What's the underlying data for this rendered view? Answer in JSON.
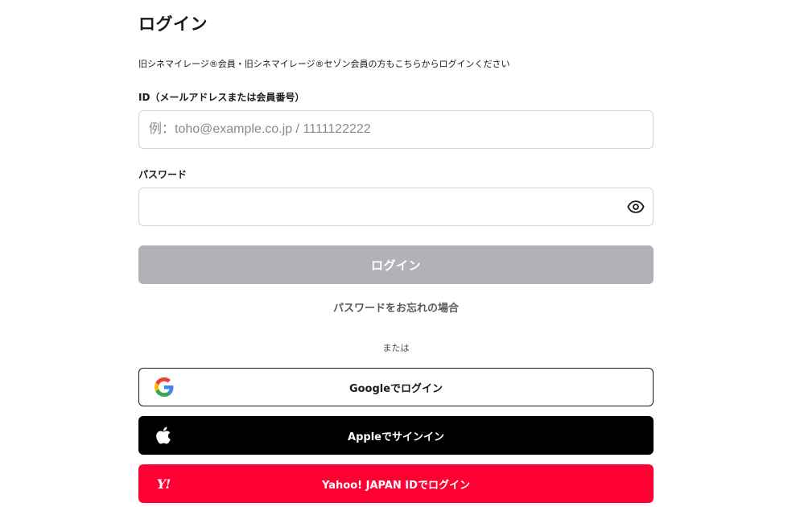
{
  "page": {
    "title": "ログイン",
    "notice": "旧シネマイレージ®会員・旧シネマイレージ®セゾン会員の方もこちらからログインください"
  },
  "form": {
    "id_label": "ID（メールアドレスまたは会員番号）",
    "id_placeholder": "例：toho@example.co.jp / 1111122222",
    "id_value": "",
    "password_label": "パスワード",
    "password_value": "",
    "password_toggle_icon": "eye-icon",
    "login_label": "ログイン",
    "forgot_label": "パスワードをお忘れの場合"
  },
  "divider": {
    "label": "または"
  },
  "social": {
    "google_label": "Googleでログイン",
    "google_icon": "google-icon",
    "apple_label": "Appleでサインイン",
    "apple_icon": "apple-icon",
    "yahoo_label": "Yahoo! JAPAN IDでログイン",
    "yahoo_logo": "Y!",
    "yahoo_icon": "yahoo-icon"
  },
  "colors": {
    "login_button_disabled": "#b1b2b6",
    "apple_button": "#000000",
    "yahoo_button": "#ff0033",
    "google_border": "#1a1a1a"
  }
}
